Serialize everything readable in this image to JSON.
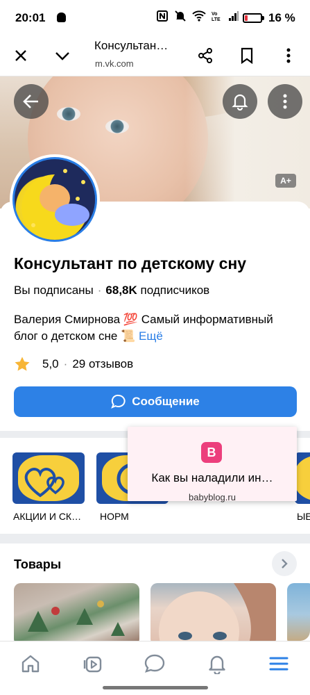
{
  "status_bar": {
    "time": "20:01",
    "battery_percent": 16,
    "battery_label": "16 %",
    "icons": [
      "nfc-icon",
      "mute-icon",
      "wifi-icon",
      "volte-icon",
      "signal-icon",
      "battery-icon"
    ]
  },
  "browser": {
    "title": "Консультан…",
    "url": "m.vk.com",
    "icons": [
      "close-icon",
      "chevron-down-icon",
      "share-icon",
      "bookmark-icon",
      "more-vertical-icon"
    ]
  },
  "cover": {
    "font_size_label": "A+"
  },
  "profile": {
    "name": "Консультант по детскому сну",
    "subscribed_label": "Вы подписаны",
    "followers_count": "68,8K",
    "followers_word": "подписчиков",
    "description": "Валерия Смирнова 💯 Самый информативный блог о детском сне 📜",
    "more_label": "Ещё",
    "rating_value": "5,0",
    "reviews_label": "29 отзывов",
    "message_button": "Сообщение"
  },
  "links": [
    {
      "label": "АКЦИИ И СК…"
    },
    {
      "label": "НОРМ"
    },
    {
      "label": "ЫЕ"
    }
  ],
  "popup": {
    "logo_letter": "B",
    "title": "Как вы наладили ин…",
    "url": "babyblog.ru"
  },
  "goods": {
    "title": "Товары"
  },
  "bottom_nav": [
    "home-icon",
    "video-icon",
    "messages-icon",
    "notifications-icon",
    "menu-icon"
  ],
  "colors": {
    "accent": "#2d81e6",
    "popup_bg": "#fff1f5",
    "popup_logo": "#ec3f7c",
    "battery_low": "#e5303a"
  }
}
